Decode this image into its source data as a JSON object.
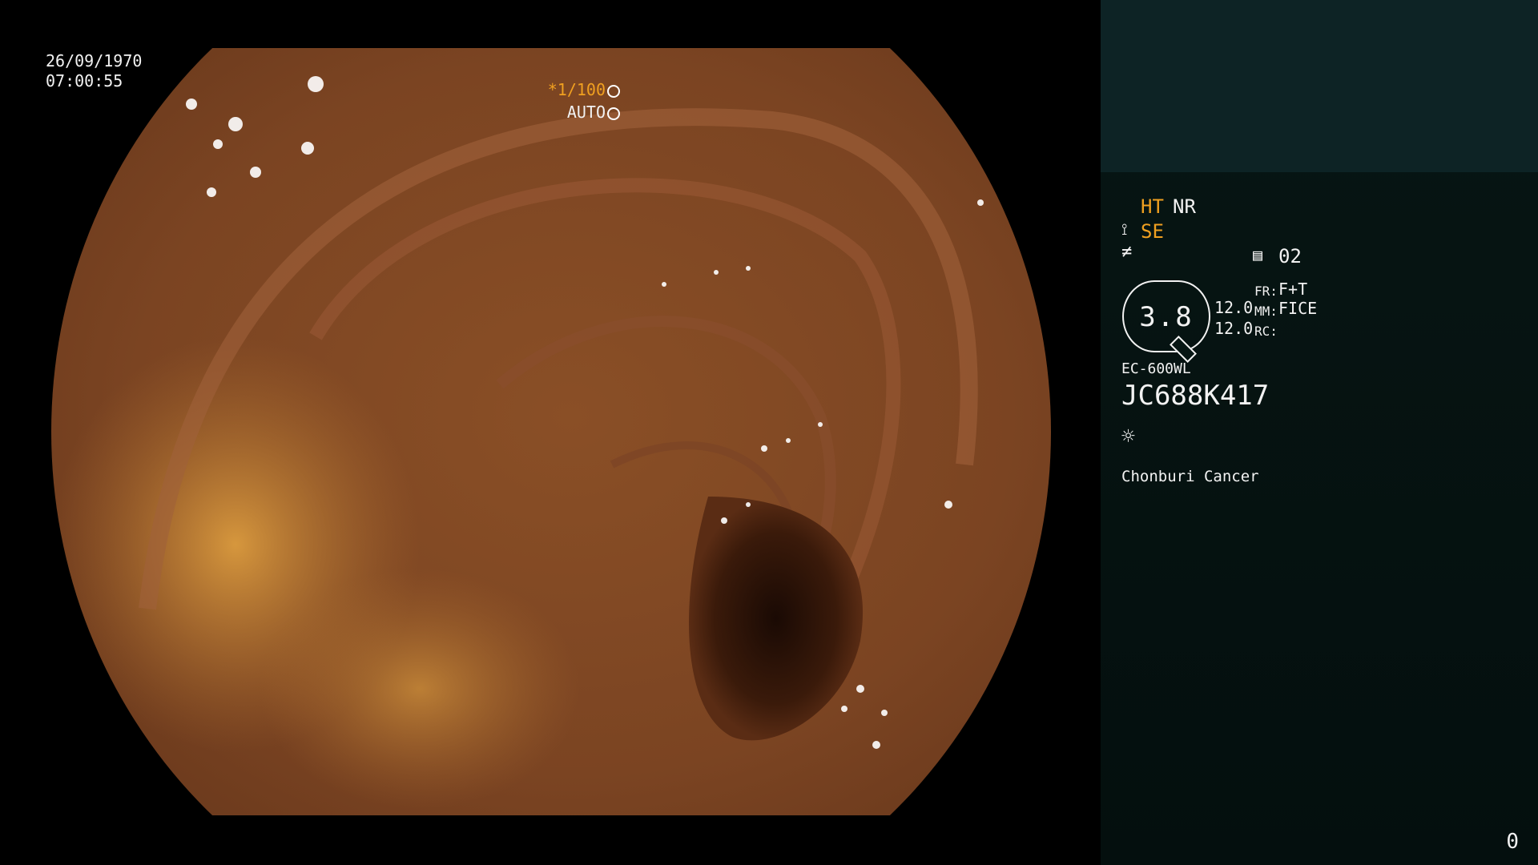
{
  "video": {
    "date": "26/09/1970",
    "time": "07:00:55",
    "shutter_speed": "*1/100",
    "exposure_mode": "AUTO",
    "icons": [
      "shutter-icon",
      "iris-icon"
    ]
  },
  "panel": {
    "ht_label": "HT",
    "nr_label": "NR",
    "se_label": "SE",
    "record_count": "02",
    "zoom_value": "3.8",
    "level_top": "12.0",
    "level_bottom": "12.0",
    "fr_label": "FR:",
    "fr_value": "F+T",
    "mm_label": "MM:",
    "mm_value": "FICE",
    "rc_label": "RC:",
    "scope_model": "EC-600WL",
    "scope_serial": "JC688K417",
    "institution": "Chonburi Cancer",
    "frame_counter": "0",
    "icons": [
      "structure-enhance-icon",
      "edge-icon",
      "record-icon",
      "light-sun-icon"
    ],
    "colors": {
      "accent": "#f0a020",
      "text": "#f2f2f2",
      "panel_bg": "#071614",
      "header_bg": "#0d2325"
    }
  }
}
